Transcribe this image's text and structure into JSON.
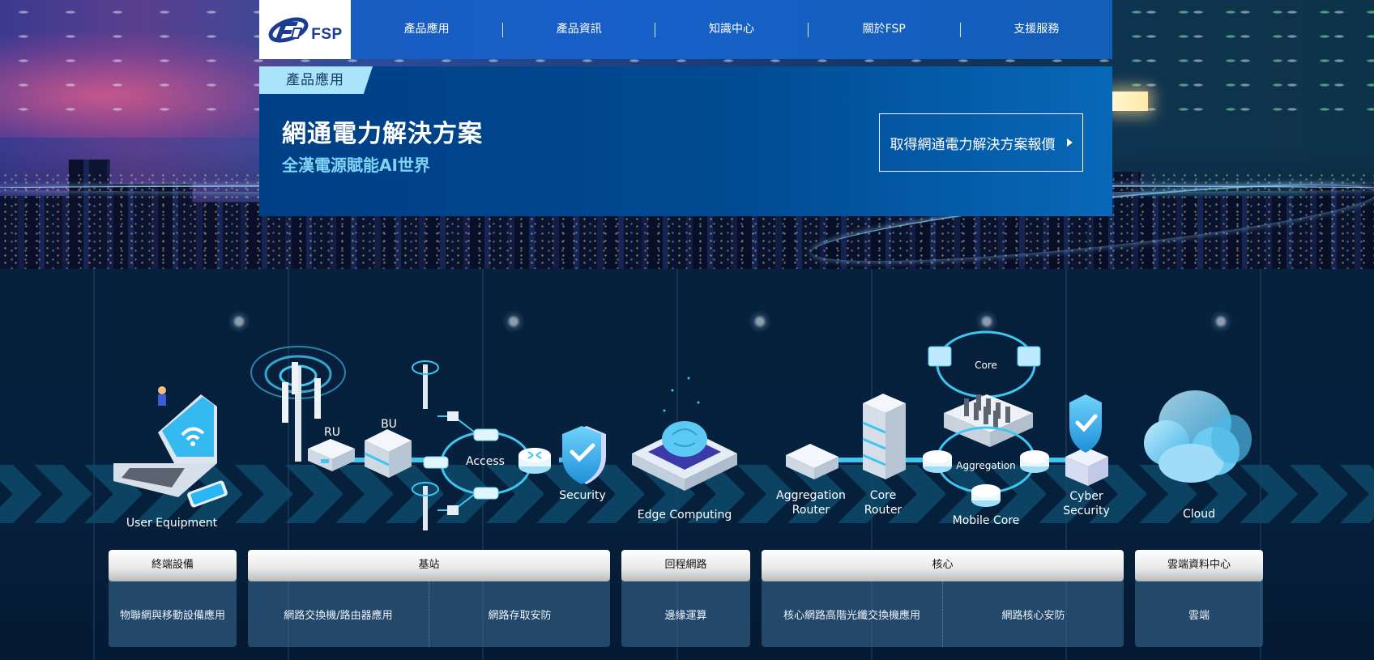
{
  "brand": {
    "logo_text": "FSP"
  },
  "nav": {
    "items": [
      {
        "label": "產品應用"
      },
      {
        "label": "產品資訊"
      },
      {
        "label": "知識中心"
      },
      {
        "label": "關於FSP"
      },
      {
        "label": "支援服務"
      }
    ]
  },
  "hero": {
    "tab_label": "產品應用",
    "title": "網通電力解決方案",
    "subtitle": "全漢電源賦能AI世界",
    "cta_label": "取得網通電力解決方案報價",
    "cta_icon": "play-arrow-icon"
  },
  "diagram": {
    "labels": {
      "user_equipment": "User Equipment",
      "ru": "RU",
      "bu": "BU",
      "access": "Access",
      "security": "Security",
      "edge_computing": "Edge Computing",
      "aggregation_router_line1": "Aggregation",
      "aggregation_router_line2": "Router",
      "core_router_line1": "Core",
      "core_router_line2": "Router",
      "core": "Core",
      "aggregation": "Aggregation",
      "mobile_core": "Mobile Core",
      "cyber_security_line1": "Cyber",
      "cyber_security_line2": "Security",
      "cloud": "Cloud"
    },
    "colors": {
      "accent": "#3fc6f0",
      "device": "#d9e4f1",
      "screen": "#29b6f6"
    }
  },
  "categories": [
    {
      "title": "終端設備",
      "items": [
        "物聯網與移動設備應用"
      ]
    },
    {
      "title": "基站",
      "items": [
        "網路交換機/路由器應用",
        "網路存取安防"
      ]
    },
    {
      "title": "回程網路",
      "items": [
        "邊緣運算"
      ]
    },
    {
      "title": "核心",
      "items": [
        "核心網路高階光纖交換機應用",
        "網路核心安防"
      ]
    },
    {
      "title": "雲端資料中心",
      "items": [
        "雲端"
      ]
    }
  ]
}
